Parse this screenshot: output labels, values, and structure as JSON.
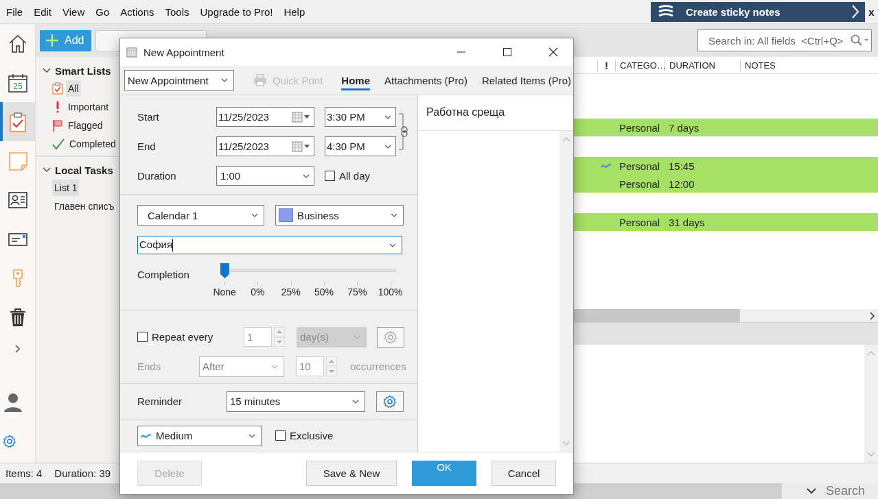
{
  "menu": [
    "File",
    "Edit",
    "View",
    "Go",
    "Actions",
    "Tools",
    "Upgrade to Pro!",
    "Help"
  ],
  "promo": {
    "text": "Create sticky notes",
    "close": "x"
  },
  "nav_rail": [
    {
      "kind": "home",
      "selected": false
    },
    {
      "kind": "calendar",
      "selected": false,
      "day": "25"
    },
    {
      "kind": "tasks",
      "selected": true
    },
    {
      "kind": "notes",
      "selected": false
    },
    {
      "kind": "contacts",
      "selected": false
    },
    {
      "kind": "mail",
      "selected": false
    },
    {
      "kind": "passwords",
      "selected": false
    },
    {
      "kind": "trash",
      "selected": false
    }
  ],
  "nav_rail_bottom": [
    {
      "kind": "account"
    },
    {
      "kind": "settings"
    }
  ],
  "toolbar": [
    {
      "kind": "add",
      "label": "Add"
    }
  ],
  "search": {
    "placeholder": "Search in: All fields  <Ctrl+Q>"
  },
  "sidebar": [
    {
      "title": "Smart Lists",
      "expanded": true,
      "items": [
        {
          "kind": "all",
          "label": "All",
          "selected": true
        },
        {
          "kind": "important",
          "label": "Important",
          "selected": false
        },
        {
          "kind": "flagged",
          "label": "Flagged",
          "selected": false
        },
        {
          "kind": "completed",
          "label": "Completed",
          "selected": false
        }
      ]
    },
    {
      "title": "Local Tasks",
      "expanded": true,
      "items": [
        {
          "kind": "list",
          "label": "List 1",
          "selected": true
        },
        {
          "kind": "list",
          "label": "Главен списъ",
          "selected": false
        }
      ]
    }
  ],
  "table": {
    "columns": [
      "!",
      "CATEGO…",
      "DURATION",
      "NOTES"
    ],
    "rows": [
      {
        "kind": "group"
      },
      {
        "kind": "group"
      },
      {
        "kind": "item",
        "highlighted": true,
        "medium_priority": false,
        "category": "Personal",
        "duration": "7 days"
      },
      {
        "kind": "group"
      },
      {
        "kind": "item",
        "highlighted": true,
        "medium_priority": true,
        "category": "Personal",
        "duration": "15:45"
      },
      {
        "kind": "item",
        "highlighted": true,
        "medium_priority": false,
        "category": "Personal",
        "duration": "12:00"
      },
      {
        "kind": "group"
      },
      {
        "kind": "item",
        "highlighted": true,
        "medium_priority": false,
        "category": "Personal",
        "duration": "31 days"
      }
    ]
  },
  "status_bar": [
    "Items: 4",
    "Duration: 39"
  ],
  "taskbar": {
    "search": "Search"
  },
  "dialog": {
    "title": "New Appointment",
    "form": "New Appointment",
    "quick_print": {
      "label": "Quick Print",
      "disabled": true
    },
    "tabs": [
      {
        "label": "Home",
        "selected": true
      },
      {
        "label": "Attachments (Pro)",
        "selected": false
      },
      {
        "label": "Related Items (Pro)",
        "selected": false
      }
    ],
    "start": {
      "label": "Start",
      "date": "11/25/2023",
      "time": "3:30 PM"
    },
    "end": {
      "label": "End",
      "date": "11/25/2023",
      "time": "4:30 PM"
    },
    "duration": {
      "label": "Duration",
      "value": "1:00"
    },
    "all_day": {
      "label": "All day",
      "checked": false
    },
    "calendar": "Calendar 1",
    "category": {
      "value": "Business",
      "color": "#8a9de8"
    },
    "location": {
      "value": "София",
      "focused": true
    },
    "completion": {
      "label": "Completion",
      "level": 0,
      "ticks": [
        "None",
        "0%",
        "25%",
        "50%",
        "75%",
        "100%"
      ]
    },
    "repeat": {
      "label": "Repeat every",
      "checked": false,
      "interval": "1",
      "unit": "day(s)",
      "ends_label": "Ends",
      "ends": "After",
      "count": "10",
      "count_label": "occurrences"
    },
    "reminder": {
      "label": "Reminder",
      "value": "15 minutes"
    },
    "priority": "Medium",
    "exclusive": {
      "label": "Exclusive",
      "checked": false
    },
    "subject": "Работна среща",
    "buttons": [
      {
        "kind": "default",
        "label": "Delete",
        "disabled": true
      },
      {
        "kind": "default",
        "label": "Save & New",
        "disabled": false
      },
      {
        "kind": "primary",
        "label": "OK",
        "disabled": false
      },
      {
        "kind": "default",
        "label": "Cancel",
        "disabled": false
      }
    ]
  }
}
